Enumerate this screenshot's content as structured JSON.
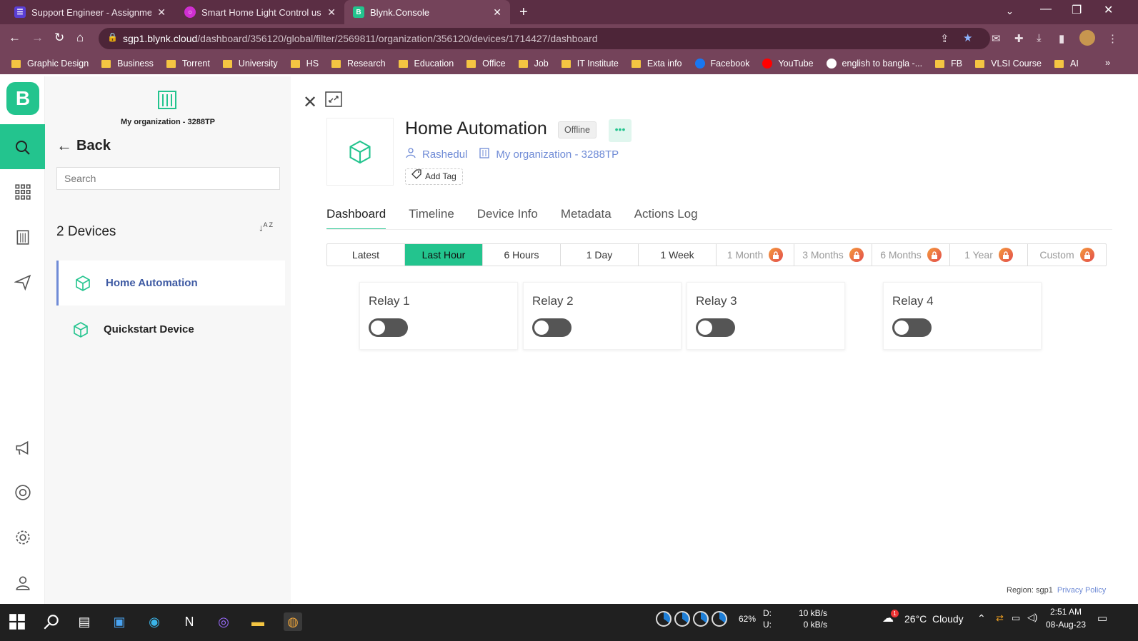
{
  "browser": {
    "tabs": [
      {
        "title": "Support Engineer - Assignment R",
        "color": "#5a3fd6"
      },
      {
        "title": "Smart Home Light Control using",
        "color": "#d02fd1"
      },
      {
        "title": "Blynk.Console",
        "color": "#23c48e"
      }
    ],
    "url_host": "sgp1.blynk.cloud",
    "url_path": "/dashboard/356120/global/filter/2569811/organization/356120/devices/1714427/dashboard",
    "bookmarks": [
      {
        "label": "Graphic Design",
        "kind": "folder"
      },
      {
        "label": "Business",
        "kind": "folder"
      },
      {
        "label": "Torrent",
        "kind": "folder"
      },
      {
        "label": "University",
        "kind": "folder"
      },
      {
        "label": "HS",
        "kind": "folder"
      },
      {
        "label": "Research",
        "kind": "folder"
      },
      {
        "label": "Education",
        "kind": "folder"
      },
      {
        "label": "Office",
        "kind": "folder"
      },
      {
        "label": "Job",
        "kind": "folder"
      },
      {
        "label": "IT Institute",
        "kind": "folder"
      },
      {
        "label": "Exta info",
        "kind": "folder"
      },
      {
        "label": "Facebook",
        "kind": "facebook"
      },
      {
        "label": "YouTube",
        "kind": "youtube"
      },
      {
        "label": "english to bangla -...",
        "kind": "google"
      },
      {
        "label": "FB",
        "kind": "folder"
      },
      {
        "label": "VLSI Course",
        "kind": "folder"
      },
      {
        "label": "AI",
        "kind": "folder"
      }
    ]
  },
  "app": {
    "logo_letter": "B",
    "accent": "#23c48e",
    "org_name": "My organization - 3288TP",
    "back_label": "Back",
    "search_placeholder": "Search",
    "device_count": "2 Devices",
    "sort_label": "A Z",
    "devices": [
      {
        "name": "Home Automation",
        "active": true
      },
      {
        "name": "Quickstart Device",
        "active": false
      }
    ]
  },
  "device": {
    "title": "Home Automation",
    "status": "Offline",
    "more": "•••",
    "owner": "Rashedul",
    "organization": "My organization - 3288TP",
    "add_tag": "Add Tag",
    "tabs": [
      "Dashboard",
      "Timeline",
      "Device Info",
      "Metadata",
      "Actions Log"
    ],
    "active_tab": "Dashboard",
    "ranges": [
      {
        "label": "Latest",
        "locked": false
      },
      {
        "label": "Last Hour",
        "locked": false,
        "active": true
      },
      {
        "label": "6 Hours",
        "locked": false
      },
      {
        "label": "1 Day",
        "locked": false
      },
      {
        "label": "1 Week",
        "locked": false
      },
      {
        "label": "1 Month",
        "locked": true
      },
      {
        "label": "3 Months",
        "locked": true
      },
      {
        "label": "6 Months",
        "locked": true
      },
      {
        "label": "1 Year",
        "locked": true
      },
      {
        "label": "Custom",
        "locked": true
      }
    ],
    "widgets": [
      {
        "title": "Relay 1",
        "on": false
      },
      {
        "title": "Relay 2",
        "on": false
      },
      {
        "title": "Relay 3",
        "on": false
      },
      {
        "title": "Relay 4",
        "on": false
      }
    ]
  },
  "footer": {
    "region": "Region: sgp1",
    "privacy": "Privacy Policy"
  },
  "taskbar": {
    "cpu_percent": "62%",
    "net_down_label": "D:",
    "net_up_label": "U:",
    "net_down": "10 kB/s",
    "net_up": "0 kB/s",
    "weather": "26°C  Cloudy",
    "weather_badge": "1",
    "time": "2:51 AM",
    "date": "08-Aug-23"
  }
}
